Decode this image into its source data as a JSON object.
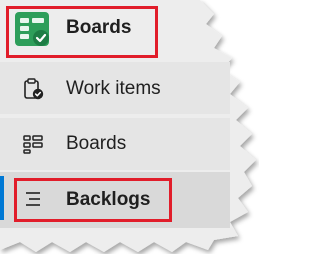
{
  "nav": {
    "header_label": "Boards",
    "items": [
      {
        "label": "Work items",
        "icon": "clipboard-check-icon"
      },
      {
        "label": "Boards",
        "icon": "boards-grid-icon"
      },
      {
        "label": "Backlogs",
        "icon": "backlog-list-icon",
        "selected": true
      }
    ]
  },
  "colors": {
    "header_icon": "#2e9e5a",
    "highlight_border": "#e11d2a",
    "selection_accent": "#0078d4",
    "item_background": "#e5e5e5",
    "selected_background": "#d9d9d9"
  }
}
